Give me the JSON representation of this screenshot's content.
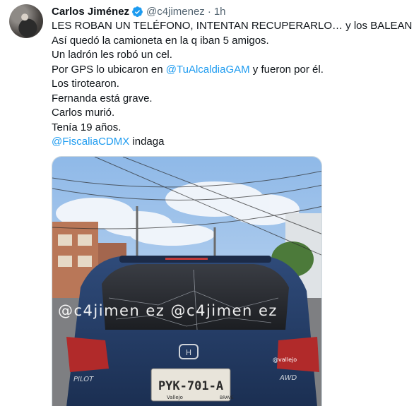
{
  "author": {
    "name": "Carlos Jiménez",
    "handle": "@c4jimenez",
    "separator": "·",
    "time": "1h"
  },
  "tweet_lines": [
    {
      "pre": "LES ROBAN UN TELÉFONO, INTENTAN RECUPERARLO… y los BALEAN"
    },
    {
      "pre": "Así quedó la camioneta en la q iban 5 amigos."
    },
    {
      "pre": "Un ladrón les robó un cel."
    },
    {
      "pre": "Por GPS lo ubicaron en ",
      "mention": "@TuAlcaldiaGAM",
      "post": " y fueron por él."
    },
    {
      "pre": "Los tirotearon."
    },
    {
      "pre": "Fernanda está grave."
    },
    {
      "pre": "Carlos murió."
    },
    {
      "pre": "Tenía 19 años."
    },
    {
      "mention": "@FiscaliaCDMX",
      "post": " indaga"
    }
  ],
  "media": {
    "watermark": "@c4jimen ez @c4jimen ez",
    "plate": "PYK-701-A",
    "plate_bottom": "Vallejo",
    "badge": "BRAVE",
    "model_left": "PILOT",
    "model_right": "AWD",
    "sticker": "@vallejo"
  },
  "colors": {
    "accent": "#1d9bf0",
    "text": "#0f1419",
    "muted": "#536471"
  }
}
